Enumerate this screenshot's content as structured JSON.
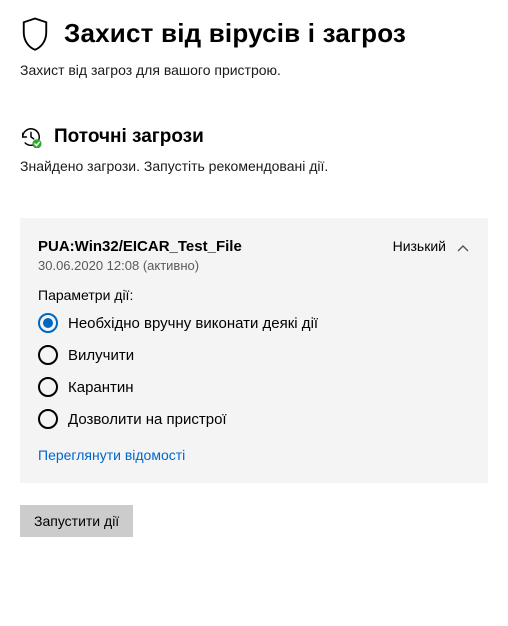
{
  "page": {
    "title": "Захист від вірусів і загроз",
    "subtitle": "Захист від загроз для вашого пристрою."
  },
  "currentThreats": {
    "heading": "Поточні загрози",
    "subtitle": "Знайдено загрози. Запустіть рекомендовані дії.",
    "threat": {
      "name": "PUA:Win32/EICAR_Test_File",
      "timestamp": "30.06.2020 12:08 (активно)",
      "severity": "Низький",
      "actionParamsLabel": "Параметри дії:",
      "options": [
        {
          "label": "Необхідно вручну виконати деякі дії",
          "selected": true
        },
        {
          "label": "Вилучити",
          "selected": false
        },
        {
          "label": "Карантин",
          "selected": false
        },
        {
          "label": "Дозволити на пристрої",
          "selected": false
        }
      ],
      "detailsLink": "Переглянути відомості"
    },
    "runActionsButton": "Запустити дії"
  }
}
